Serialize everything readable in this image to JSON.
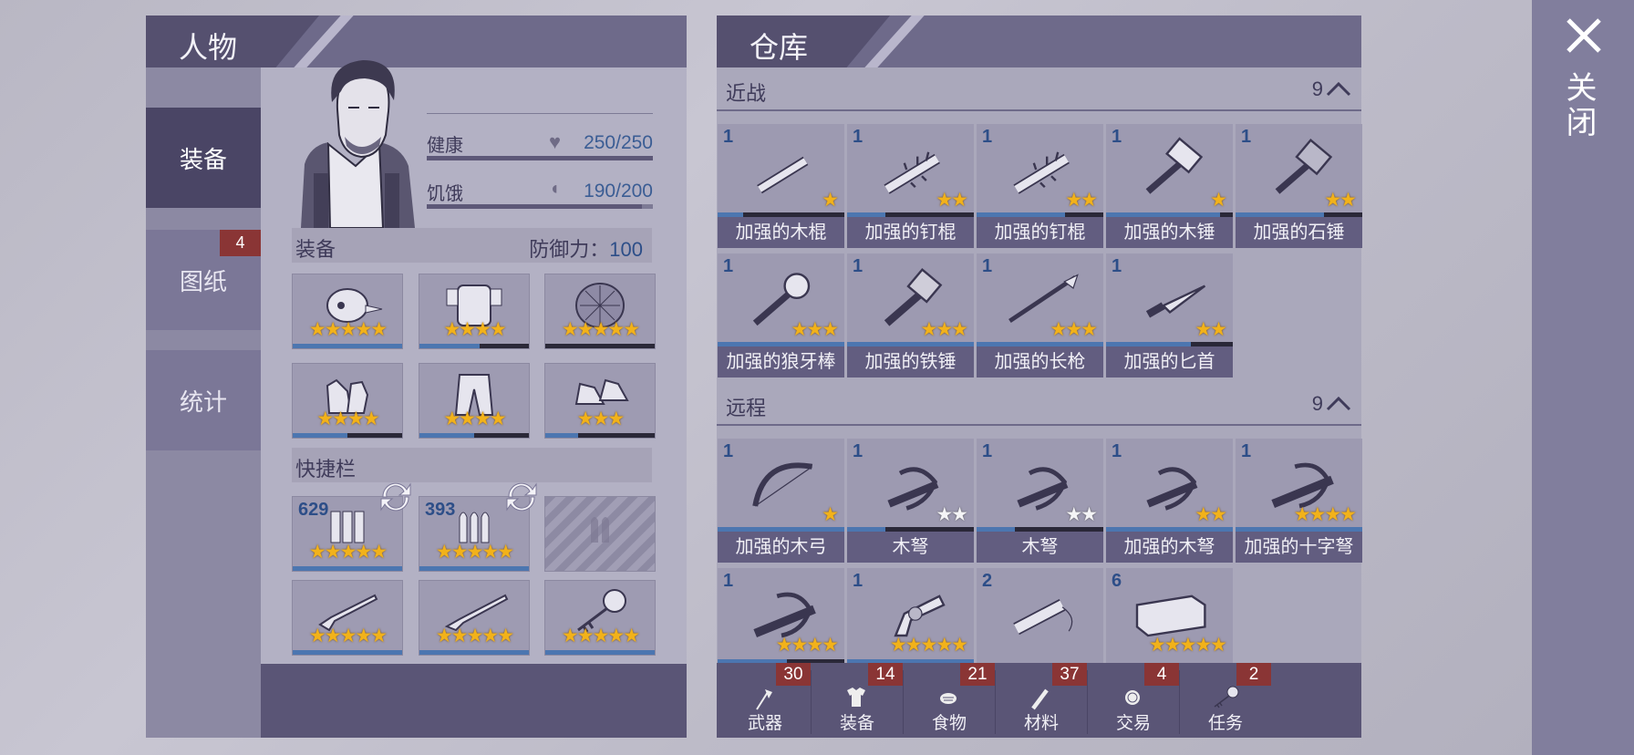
{
  "character": {
    "title": "人物",
    "nav": [
      {
        "label": "装备"
      },
      {
        "label": "图纸",
        "badge": "4"
      },
      {
        "label": "统计"
      }
    ],
    "stats": [
      {
        "label": "健康",
        "value": "250/250",
        "fill": 1.0
      },
      {
        "label": "饥饿",
        "value": "190/200",
        "fill": 0.95
      }
    ],
    "equipment": {
      "label": "装备",
      "defense_label": "防御力：",
      "defense_value": "100"
    },
    "equip_slots": [
      {
        "icon": "hat-icon",
        "stars": "★★★★★",
        "fill": 1.0
      },
      {
        "icon": "armor-icon",
        "stars": "★★★★",
        "fill": 0.55
      },
      {
        "icon": "turtle-shell-icon",
        "stars": "★★★★★",
        "fill": 0.0
      },
      {
        "icon": "gloves-icon",
        "stars": "★★★★",
        "fill": 0.5
      },
      {
        "icon": "pants-icon",
        "stars": "★★★★",
        "fill": 0.5
      },
      {
        "icon": "shoes-icon",
        "stars": "★★★",
        "fill": 0.3
      }
    ],
    "quickbar": {
      "label": "快捷栏"
    },
    "quick_slots": [
      {
        "icon": "shotgun-shells-icon",
        "count": "629",
        "stars": "★★★★★"
      },
      {
        "icon": "bullets-icon",
        "count": "393",
        "stars": "★★★★★"
      },
      {
        "icon": "empty-ammo-slot-icon",
        "count": "",
        "stars": ""
      },
      {
        "icon": "shotgun-icon",
        "count": "",
        "stars": "★★★★★"
      },
      {
        "icon": "rifle-icon",
        "count": "",
        "stars": "★★★★★"
      },
      {
        "icon": "key-icon",
        "count": "",
        "stars": "★★★★★"
      }
    ]
  },
  "warehouse": {
    "title": "仓库",
    "melee": {
      "label": "近战",
      "count": "9",
      "items": [
        {
          "count": "1",
          "name": "加强的木棍",
          "stars": "★",
          "fill": 0.2,
          "icon": "wooden-club-icon"
        },
        {
          "count": "1",
          "name": "加强的钉棍",
          "stars": "★★",
          "fill": 0.3,
          "icon": "spiked-club-icon"
        },
        {
          "count": "1",
          "name": "加强的钉棍",
          "stars": "★★",
          "fill": 0.7,
          "icon": "spiked-club-icon"
        },
        {
          "count": "1",
          "name": "加强的木锤",
          "stars": "★",
          "fill": 0.9,
          "icon": "wooden-hammer-icon"
        },
        {
          "count": "1",
          "name": "加强的石锤",
          "stars": "★★",
          "fill": 0.7,
          "icon": "stone-hammer-icon"
        },
        {
          "count": "1",
          "name": "加强的狼牙棒",
          "stars": "★★★",
          "fill": 1.0,
          "icon": "mace-icon"
        },
        {
          "count": "1",
          "name": "加强的铁锤",
          "stars": "★★★",
          "fill": 1.0,
          "icon": "iron-hammer-icon"
        },
        {
          "count": "1",
          "name": "加强的长枪",
          "stars": "★★★",
          "fill": 1.0,
          "icon": "spear-icon"
        },
        {
          "count": "1",
          "name": "加强的匕首",
          "stars": "★★",
          "fill": 0.67,
          "icon": "dagger-icon"
        }
      ]
    },
    "ranged": {
      "label": "远程",
      "count": "9",
      "items": [
        {
          "count": "1",
          "name": "加强的木弓",
          "stars": "★",
          "fill": 1.0,
          "icon": "bow-icon",
          "white": false
        },
        {
          "count": "1",
          "name": "木弩",
          "stars": "★★",
          "fill": 0.3,
          "icon": "crossbow-icon",
          "white": true
        },
        {
          "count": "1",
          "name": "木弩",
          "stars": "★★",
          "fill": 0.3,
          "icon": "crossbow-icon",
          "white": true
        },
        {
          "count": "1",
          "name": "加强的木弩",
          "stars": "★★",
          "fill": 1.0,
          "icon": "crossbow-icon",
          "white": false
        },
        {
          "count": "1",
          "name": "加强的十字弩",
          "stars": "★★★★",
          "fill": 1.0,
          "icon": "heavy-crossbow-icon",
          "white": false
        },
        {
          "count": "1",
          "name": "",
          "stars": "★★★★",
          "fill": 0.55,
          "icon": "heavy-crossbow-icon",
          "white": false
        },
        {
          "count": "1",
          "name": "",
          "stars": "★★★★★",
          "fill": 1.0,
          "icon": "revolver-icon",
          "white": false
        },
        {
          "count": "2",
          "name": "",
          "stars": "",
          "fill": 0,
          "icon": "flashlight-icon",
          "white": false
        },
        {
          "count": "6",
          "name": "",
          "stars": "★★★★★",
          "fill": 0,
          "icon": "brick-icon",
          "white": false
        }
      ]
    },
    "tabs": [
      {
        "label": "武器",
        "badge": "30",
        "icon": "axe-icon"
      },
      {
        "label": "装备",
        "badge": "14",
        "icon": "shirt-icon"
      },
      {
        "label": "食物",
        "badge": "21",
        "icon": "meat-icon"
      },
      {
        "label": "材料",
        "badge": "37",
        "icon": "wood-icon"
      },
      {
        "label": "交易",
        "badge": "4",
        "icon": "coin-icon"
      },
      {
        "label": "任务",
        "badge": "2",
        "icon": "key-icon"
      }
    ]
  },
  "close": {
    "label": "关闭"
  },
  "colors": {
    "panel_dark": "#55506f",
    "bar_blue": "#4c76b0",
    "star": "#f2b21a",
    "badge": "#8a3535"
  }
}
